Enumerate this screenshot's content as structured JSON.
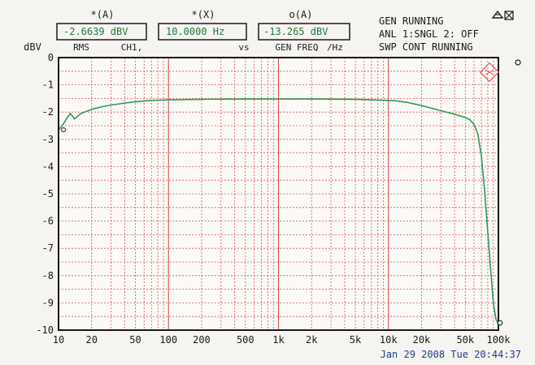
{
  "readouts": [
    {
      "header": "*(A)",
      "value": "-2.6639 dBV",
      "subtitle_left": "RMS",
      "subtitle_right": "CH1,"
    },
    {
      "header": "*(X)",
      "value": "10.0000  Hz",
      "subtitle_left": "",
      "subtitle_right": "vs"
    },
    {
      "header": "o(A)",
      "value": "-13.265 dBV",
      "subtitle_left": "GEN FREQ",
      "subtitle_right": "/Hz"
    }
  ],
  "status": {
    "line1": "GEN RUNNING",
    "line2": "ANL 1:SNGL 2: OFF",
    "line3": "SWP CONT RUNNING"
  },
  "timestamp": "Jan 29 2008 Tue 20:44:37",
  "colors": {
    "trace": "#2e9a5a",
    "grid": "#d9534f",
    "frame": "#1a1a1a",
    "readout_value": "#1f7a3a",
    "timestamp": "#1f3f8f"
  },
  "chart_data": {
    "type": "line",
    "title": "",
    "xlabel": "",
    "ylabel": "dBV",
    "x_scale": "log",
    "xlim": [
      10,
      100000
    ],
    "ylim": [
      -10,
      0
    ],
    "grid": true,
    "x_ticks": [
      {
        "v": 10,
        "label": "10"
      },
      {
        "v": 20,
        "label": "20"
      },
      {
        "v": 50,
        "label": "50"
      },
      {
        "v": 100,
        "label": "100"
      },
      {
        "v": 200,
        "label": "200"
      },
      {
        "v": 500,
        "label": "500"
      },
      {
        "v": 1000,
        "label": "1k"
      },
      {
        "v": 2000,
        "label": "2k"
      },
      {
        "v": 5000,
        "label": "5k"
      },
      {
        "v": 10000,
        "label": "10k"
      },
      {
        "v": 20000,
        "label": "20k"
      },
      {
        "v": 50000,
        "label": "50k"
      },
      {
        "v": 100000,
        "label": "100k"
      }
    ],
    "y_ticks": [
      {
        "v": 0,
        "label": "0"
      },
      {
        "v": -1,
        "label": "-1"
      },
      {
        "v": -2,
        "label": "-2"
      },
      {
        "v": -3,
        "label": "-3"
      },
      {
        "v": -4,
        "label": "-4"
      },
      {
        "v": -5,
        "label": "-5"
      },
      {
        "v": -6,
        "label": "-6"
      },
      {
        "v": -7,
        "label": "-7"
      },
      {
        "v": -8,
        "label": "-8"
      },
      {
        "v": -9,
        "label": "-9"
      },
      {
        "v": -10,
        "label": "-10"
      }
    ],
    "series": [
      {
        "x": [
          10,
          11,
          12,
          12.8,
          14,
          16,
          20,
          25,
          30,
          40,
          50,
          70,
          100,
          200,
          500,
          1000,
          2000,
          5000,
          10000,
          12000,
          15000,
          20000,
          30000,
          40000,
          50000,
          55000,
          60000,
          65000,
          70000,
          75000,
          80000,
          85000,
          90000,
          95000,
          100000
        ],
        "y": [
          -2.66,
          -2.45,
          -2.2,
          -2.05,
          -2.25,
          -2.05,
          -1.9,
          -1.8,
          -1.74,
          -1.67,
          -1.62,
          -1.57,
          -1.55,
          -1.53,
          -1.52,
          -1.52,
          -1.52,
          -1.53,
          -1.57,
          -1.59,
          -1.65,
          -1.76,
          -1.95,
          -2.08,
          -2.2,
          -2.28,
          -2.45,
          -2.8,
          -3.6,
          -4.9,
          -6.4,
          -7.8,
          -9.0,
          -9.6,
          -9.8
        ]
      }
    ]
  }
}
